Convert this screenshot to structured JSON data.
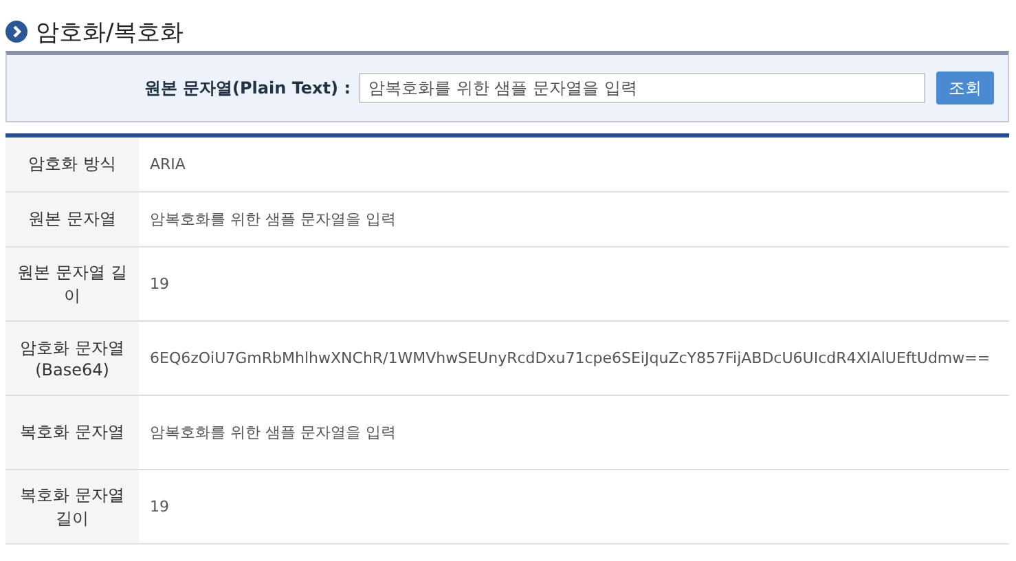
{
  "title": "암호화/복호화",
  "search": {
    "label": "원본 문자열(Plain Text) :",
    "value": "암복호화를 위한 샘플 문자열을 입력",
    "button": "조회"
  },
  "rows": [
    {
      "label": "암호화 방식",
      "value": "ARIA"
    },
    {
      "label": "원본 문자열",
      "value": "암복호화를 위한 샘플 문자열을 입력"
    },
    {
      "label": "원본 문자열 길이",
      "value": "19"
    },
    {
      "label": "암호화 문자열(Base64)",
      "value": "6EQ6zOiU7GmRbMhlhwXNChR/1WMVhwSEUnyRcdDxu71cpe6SEiJquZcY857FijABDcU6UIcdR4XlAlUEftUdmw=="
    },
    {
      "label": "복호화 문자열",
      "value": "암복호화를 위한 샘플 문자열을 입력"
    },
    {
      "label": "복호화 문자열 길이",
      "value": "19"
    }
  ]
}
